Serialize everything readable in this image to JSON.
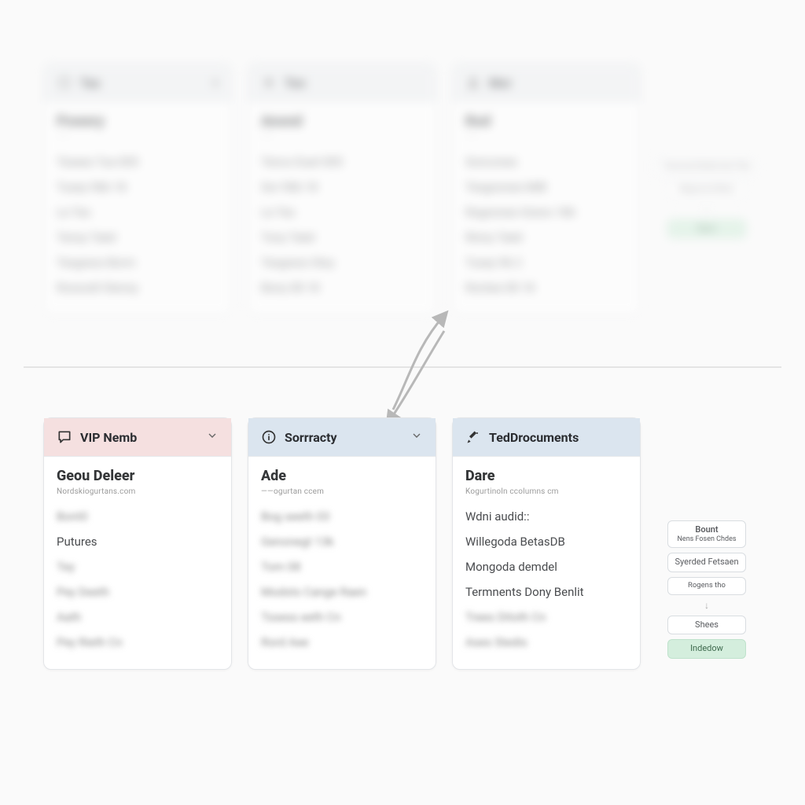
{
  "top": {
    "cards": [
      {
        "header": "Tax",
        "title": "Powery",
        "sub": "——",
        "rows": [
          "Texees Tue 005",
          "Tusey 96b 18",
          "Le Tes",
          "Tensy Tatel",
          "Tesgress Borm",
          "Rossodt Stensy"
        ]
      },
      {
        "header": "Ton",
        "title": "Anond",
        "sub": "——",
        "rows": [
          "Tencs Duet 005",
          "Sor 90b 18",
          "Le Tes",
          "Tony Tatel",
          "Tesgress Stoy",
          "Bony 08 18"
        ]
      },
      {
        "header": "Mor",
        "title": "Rod",
        "sub": "——",
        "rows": [
          "Soncones",
          "Tesgnones MiB",
          "Rognones Greno 186",
          "Rinny Tatel",
          "Tusey 9b 2",
          "Rontee 08 18"
        ]
      }
    ],
    "annos": [
      "Transcend Mode Sae Thee",
      "Megnoucd Mess",
      "Bunt"
    ]
  },
  "bottom": {
    "cards": [
      {
        "header": "VIP Nemb",
        "title": "Geou Deleer",
        "sub": "Nordskiogurtans.com",
        "rows": [
          {
            "text": "Bont0",
            "blur": true
          },
          {
            "text": "Putures",
            "blur": false
          },
          {
            "text": "Tey",
            "blur": true
          },
          {
            "text": "Pey Deeth",
            "blur": true
          },
          {
            "text": "Aath",
            "blur": true
          },
          {
            "text": "Pey Rieth Cn",
            "blur": true
          }
        ]
      },
      {
        "header": "Sorrracty",
        "title": "Ade",
        "sub": "——ogurtan ccem",
        "rows": [
          {
            "text": "Bog seeth 03",
            "blur": true
          },
          {
            "text": "Genonegt 13k",
            "blur": true
          },
          {
            "text": "Tom 08",
            "blur": true
          },
          {
            "text": "Modsts Cange Raen",
            "blur": true
          },
          {
            "text": "Tssess eeth Cn",
            "blur": true
          },
          {
            "text": "Rord Aee",
            "blur": true
          }
        ]
      },
      {
        "header": "TedDrocuments",
        "title": "Dare",
        "sub": "Kogurtinoln ccolumns cm",
        "rows": [
          {
            "text": "Wdni audid::",
            "blur": false
          },
          {
            "text": "Willegoda BetasDB",
            "blur": false
          },
          {
            "text": "Mongoda demdel",
            "blur": false
          },
          {
            "text": "Termnents Dony Benlit",
            "blur": false
          },
          {
            "text": "Trees Ditoth Cn",
            "blur": true
          },
          {
            "text": "Ases Stedis",
            "blur": true
          }
        ]
      }
    ],
    "annos": {
      "group1": {
        "a": "Bount",
        "b": "Nens Fosen Chdes"
      },
      "group2": "Syerded Fetsaen",
      "group3": "Rogens tho",
      "group4": "Shees",
      "group5": "Indedow"
    }
  }
}
